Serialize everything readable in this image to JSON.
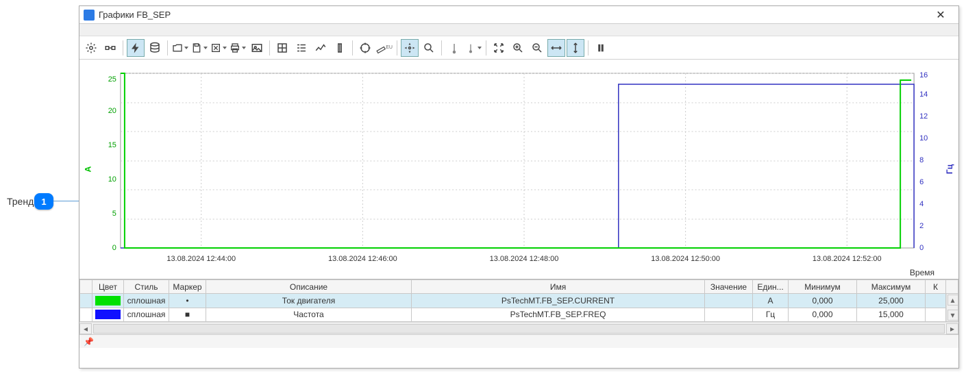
{
  "callout": {
    "label": "Тренд",
    "num": "1"
  },
  "window": {
    "title": "Графики FB_SEP"
  },
  "chart": {
    "ylabel_left": "А",
    "ylabel_right": "Гц",
    "xlabel": "Время"
  },
  "chart_data": {
    "type": "line",
    "xlabel": "Время",
    "x_ticks": [
      "13.08.2024 12:44:00",
      "13.08.2024 12:46:00",
      "13.08.2024 12:48:00",
      "13.08.2024 12:50:00",
      "13.08.2024 12:52:00"
    ],
    "left_axis": {
      "label": "А",
      "min": 0,
      "max": 25,
      "ticks": [
        0,
        5,
        10,
        15,
        20,
        25
      ]
    },
    "right_axis": {
      "label": "Гц",
      "min": 0,
      "max": 16,
      "ticks": [
        0,
        2,
        4,
        6,
        8,
        10,
        12,
        14,
        16
      ]
    },
    "series": [
      {
        "name": "Ток двигателя",
        "tag": "PsTechMT.FB_SEP.CURRENT",
        "axis": "left",
        "color": "#00e000",
        "points": [
          {
            "x": "12:43:00",
            "y": 27
          },
          {
            "x": "12:43:05",
            "y": 0
          },
          {
            "x": "12:52:40",
            "y": 0
          },
          {
            "x": "12:52:40",
            "y": 25
          },
          {
            "x": "12:52:48",
            "y": 25
          }
        ]
      },
      {
        "name": "Частота",
        "tag": "PsTechMT.FB_SEP.FREQ",
        "axis": "right",
        "color": "#3030c0",
        "points": [
          {
            "x": "12:43:00",
            "y": 0
          },
          {
            "x": "12:49:10",
            "y": 0
          },
          {
            "x": "12:49:10",
            "y": 15
          },
          {
            "x": "12:52:48",
            "y": 15
          }
        ]
      }
    ]
  },
  "table": {
    "headers": {
      "color": "Цвет",
      "style": "Стиль",
      "marker": "Маркер",
      "desc": "Описание",
      "name": "Имя",
      "value": "Значение",
      "unit": "Един...",
      "min": "Минимум",
      "max": "Максимум",
      "k": "К"
    },
    "rows": [
      {
        "color": "#00e000",
        "style": "сплошная",
        "marker": "•",
        "desc": "Ток двигателя",
        "name": "PsTechMT.FB_SEP.CURRENT",
        "value": "",
        "unit": "А",
        "min": "0,000",
        "max": "25,000",
        "k": ""
      },
      {
        "color": "#1010ff",
        "style": "сплошная",
        "marker": "■",
        "desc": "Частота",
        "name": "PsTechMT.FB_SEP.FREQ",
        "value": "",
        "unit": "Гц",
        "min": "0,000",
        "max": "15,000",
        "k": ""
      }
    ]
  }
}
